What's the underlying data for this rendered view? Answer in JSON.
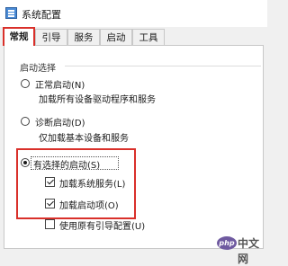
{
  "window": {
    "title": "系统配置",
    "icon": "msconfig-icon"
  },
  "tabs": [
    {
      "label": "常规",
      "active": true
    },
    {
      "label": "引导",
      "active": false
    },
    {
      "label": "服务",
      "active": false
    },
    {
      "label": "启动",
      "active": false
    },
    {
      "label": "工具",
      "active": false
    }
  ],
  "startup": {
    "group_label": "启动选择",
    "normal": {
      "label": "正常启动(N)",
      "description": "加载所有设备驱动程序和服务",
      "checked": false
    },
    "diagnostic": {
      "label": "诊断启动(D)",
      "description": "仅加载基本设备和服务",
      "checked": false
    },
    "selective": {
      "label": "有选择的启动(S)",
      "checked": true,
      "options": [
        {
          "label": "加载系统服务(L)",
          "checked": true
        },
        {
          "label": "加载启动项(O)",
          "checked": true
        },
        {
          "label": "使用原有引导配置(U)",
          "checked": false
        }
      ]
    }
  },
  "watermark": {
    "badge": "php",
    "text": "中文网"
  },
  "colors": {
    "highlight": "#d9302a",
    "panel": "#ffffff",
    "window_bg": "#f0f0f0"
  }
}
